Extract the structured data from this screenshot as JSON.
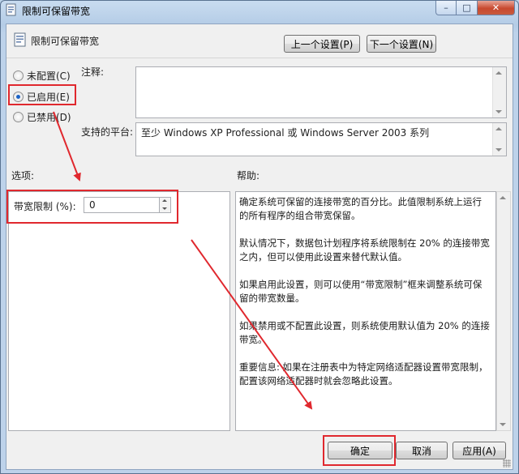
{
  "window": {
    "title": "限制可保留带宽",
    "min_glyph": "–",
    "max_glyph": "□",
    "close_glyph": "✕"
  },
  "header": {
    "policy_title": "限制可保留带宽",
    "prev_label": "上一个设置(P)",
    "next_label": "下一个设置(N)"
  },
  "state": {
    "not_configured": "未配置(C)",
    "enabled": "已启用(E)",
    "disabled": "已禁用(D)",
    "selected": "enabled"
  },
  "comment": {
    "label": "注释:",
    "value": ""
  },
  "platform": {
    "label": "支持的平台:",
    "value": "至少 Windows XP Professional 或 Windows Server 2003 系列"
  },
  "options": {
    "label": "选项:",
    "bandwidth_label": "带宽限制 (%):",
    "bandwidth_value": "0"
  },
  "help": {
    "label": "帮助:",
    "paragraphs": [
      "确定系统可保留的连接带宽的百分比。此值限制系统上运行的所有程序的组合带宽保留。",
      "默认情况下，数据包计划程序将系统限制在 20% 的连接带宽之内，但可以使用此设置来替代默认值。",
      "如果启用此设置，则可以使用“带宽限制”框来调整系统可保留的带宽数量。",
      "如果禁用或不配置此设置，则系统使用默认值为 20% 的连接带宽。",
      "重要信息: 如果在注册表中为特定网络适配器设置带宽限制，配置该网络适配器时就会忽略此设置。"
    ]
  },
  "footer": {
    "ok_label": "确定",
    "cancel_label": "取消",
    "apply_label": "应用(A)"
  },
  "colors": {
    "highlight": "#e0282e",
    "radio_dot": "#1b63c6"
  }
}
